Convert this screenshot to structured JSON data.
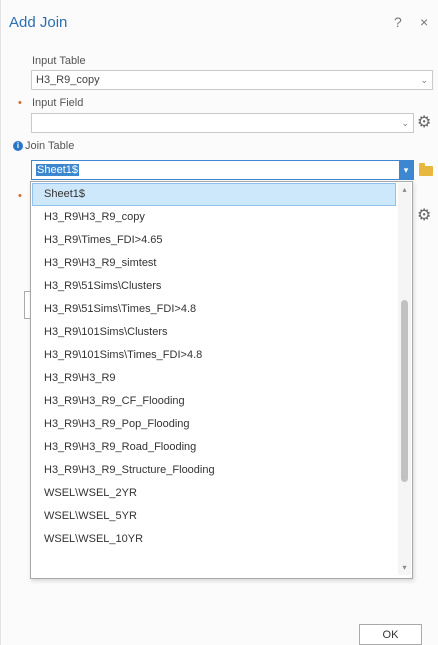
{
  "window": {
    "title": "Add Join",
    "help_glyph": "?",
    "close_glyph": "×"
  },
  "form": {
    "input_table": {
      "label": "Input Table",
      "value": "H3_R9_copy"
    },
    "input_field": {
      "label": "Input Field",
      "value": ""
    },
    "join_table": {
      "label": "Join Table",
      "value": "Sheet1$",
      "info_glyph": "i"
    }
  },
  "dropdown": {
    "selected_index": 0,
    "items": [
      "Sheet1$",
      "H3_R9\\H3_R9_copy",
      "H3_R9\\Times_FDI>4.65",
      "H3_R9\\H3_R9_simtest",
      "H3_R9\\51Sims\\Clusters",
      "H3_R9\\51Sims\\Times_FDI>4.8",
      "H3_R9\\101Sims\\Clusters",
      "H3_R9\\101Sims\\Times_FDI>4.8",
      "H3_R9\\H3_R9",
      "H3_R9\\H3_R9_CF_Flooding",
      "H3_R9\\H3_R9_Pop_Flooding",
      "H3_R9\\H3_R9_Road_Flooding",
      "H3_R9\\H3_R9_Structure_Flooding",
      "WSEL\\WSEL_2YR",
      "WSEL\\WSEL_5YR",
      "WSEL\\WSEL_10YR"
    ]
  },
  "footer": {
    "ok_label": "OK"
  },
  "icons": {
    "gear": "gear-icon",
    "folder": "folder-icon",
    "dropdown": "chevron-down-icon",
    "info": "info-icon"
  },
  "colors": {
    "accent": "#3d87d1",
    "title": "#2a6fb5",
    "required": "#d46a22",
    "selected_row": "#cde8fb"
  }
}
